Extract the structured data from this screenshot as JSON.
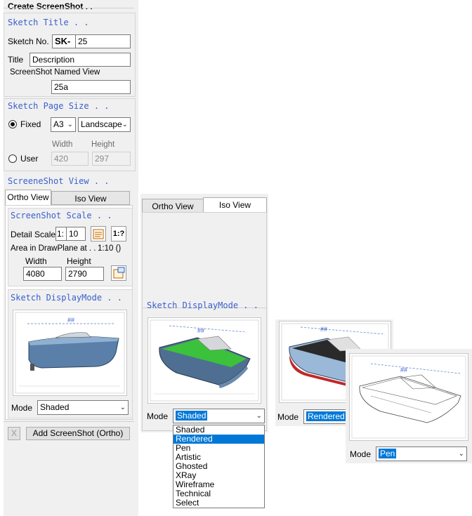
{
  "panel": {
    "title": "Create ScreenShot . .",
    "sketch_title": {
      "header": "Sketch Title . .",
      "number_label": "Sketch No.",
      "prefix": "SK-",
      "number_value": "25",
      "title_label": "Title",
      "title_value": "Description",
      "named_view_label": "ScreenShot Named View",
      "named_view_value": "25a"
    },
    "page_size": {
      "header": "Sketch Page Size . .",
      "fixed_label": "Fixed",
      "paper": "A3",
      "orientation": "Landscape",
      "user_label": "User",
      "width_label": "Width",
      "height_label": "Height",
      "width_value": "420",
      "height_value": "297",
      "selected": "Fixed"
    },
    "view": {
      "header": "ScreeneShot View . .",
      "tabs": [
        "Ortho View",
        "Iso View"
      ],
      "active_tab": "Ortho View"
    },
    "scale": {
      "header": "ScreenShot Scale . .",
      "detail_label": "Detail Scale",
      "ratio_prefix": "1:",
      "ratio_value": "10",
      "fit_icon_text": "1:?",
      "area_label": "Area in DrawPlane at . .",
      "area_scale": "1:10 ()",
      "width_label": "Width",
      "height_label": "Height",
      "width_value": "4080",
      "height_value": "2790"
    },
    "display": {
      "header": "Sketch DisplayMode . .",
      "mode_label": "Mode",
      "mode_value": "Shaded",
      "dim_text": "##"
    },
    "close_label": "X",
    "add_button": "Add ScreenShot (Ortho)"
  },
  "iso_panel": {
    "tabs": [
      "Ortho View",
      "Iso View"
    ],
    "active_tab": "Iso View",
    "display_header": "Sketch DisplayMode . .",
    "mode_label": "Mode",
    "mode_value": "Shaded",
    "dim_text": "##",
    "dropdown_options": [
      "Shaded",
      "Rendered",
      "Pen",
      "Artistic",
      "Ghosted",
      "XRay",
      "Wireframe",
      "Technical",
      "Select"
    ],
    "highlighted_option": "Rendered"
  },
  "rendered_panel": {
    "mode_label": "Mode",
    "mode_value": "Rendered",
    "dim_text": "##"
  },
  "pen_panel": {
    "mode_label": "Mode",
    "mode_value": "Pen",
    "dim_text": "##"
  },
  "colors": {
    "accent": "#3a5fcd",
    "selection": "#0078d7",
    "hull": "#5a7fa8",
    "deck_green": "#3cc13c",
    "boot_red": "#c0282a"
  }
}
